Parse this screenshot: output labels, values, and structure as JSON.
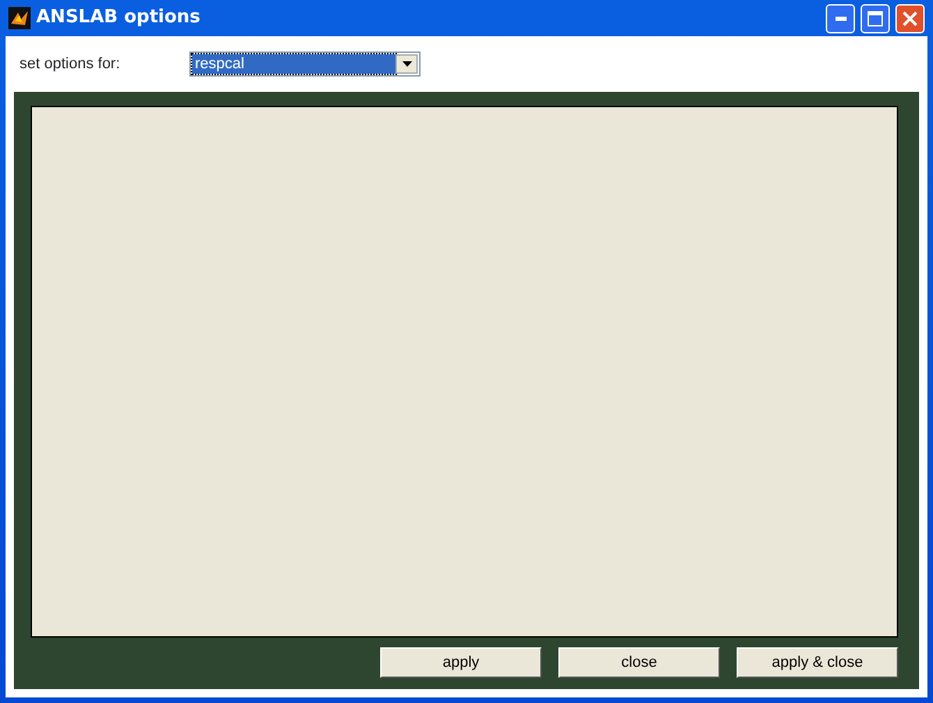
{
  "window": {
    "title": "ANSLAB options"
  },
  "options_for": {
    "label": "set options for:",
    "value": "respcal",
    "focused": true
  },
  "buttons": [
    {
      "label": "apply"
    },
    {
      "label": "close"
    },
    {
      "label": "apply & close"
    }
  ]
}
